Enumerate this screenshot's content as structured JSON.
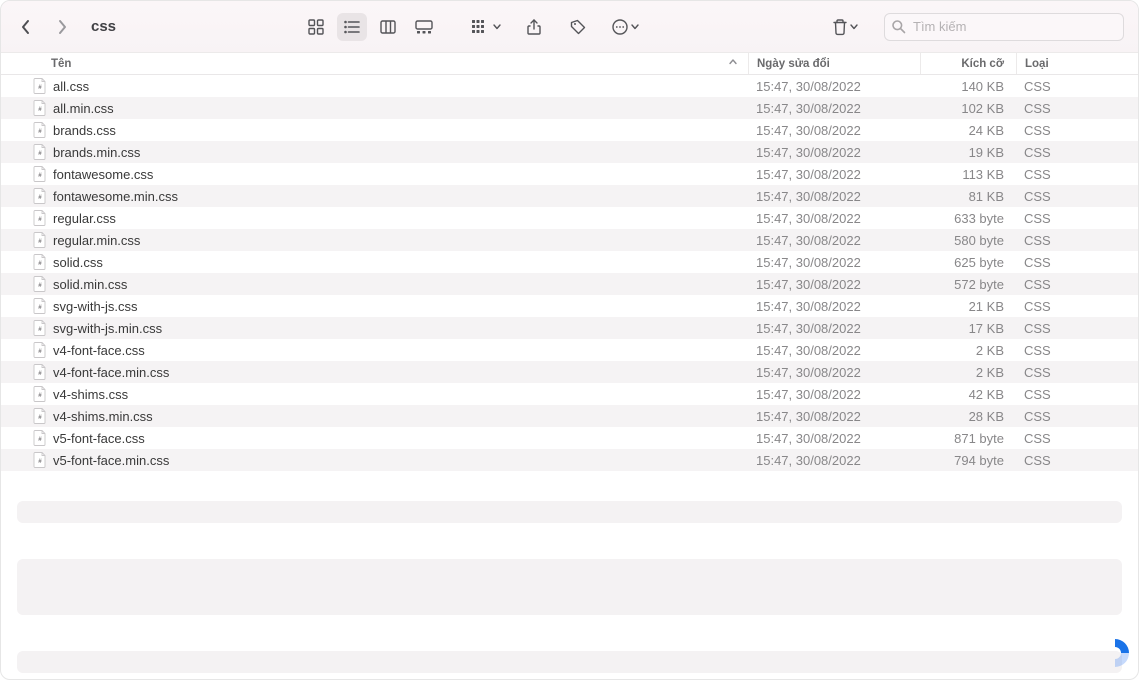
{
  "toolbar": {
    "folder_title": "css"
  },
  "search": {
    "placeholder": "Tìm kiếm"
  },
  "columns": {
    "name": "Tên",
    "date": "Ngày sửa đổi",
    "size": "Kích cỡ",
    "kind": "Loại"
  },
  "files": [
    {
      "name": "all.css",
      "date": "15:47, 30/08/2022",
      "size": "140 KB",
      "kind": "CSS"
    },
    {
      "name": "all.min.css",
      "date": "15:47, 30/08/2022",
      "size": "102 KB",
      "kind": "CSS"
    },
    {
      "name": "brands.css",
      "date": "15:47, 30/08/2022",
      "size": "24 KB",
      "kind": "CSS"
    },
    {
      "name": "brands.min.css",
      "date": "15:47, 30/08/2022",
      "size": "19 KB",
      "kind": "CSS"
    },
    {
      "name": "fontawesome.css",
      "date": "15:47, 30/08/2022",
      "size": "113 KB",
      "kind": "CSS"
    },
    {
      "name": "fontawesome.min.css",
      "date": "15:47, 30/08/2022",
      "size": "81 KB",
      "kind": "CSS"
    },
    {
      "name": "regular.css",
      "date": "15:47, 30/08/2022",
      "size": "633 byte",
      "kind": "CSS"
    },
    {
      "name": "regular.min.css",
      "date": "15:47, 30/08/2022",
      "size": "580 byte",
      "kind": "CSS"
    },
    {
      "name": "solid.css",
      "date": "15:47, 30/08/2022",
      "size": "625 byte",
      "kind": "CSS"
    },
    {
      "name": "solid.min.css",
      "date": "15:47, 30/08/2022",
      "size": "572 byte",
      "kind": "CSS"
    },
    {
      "name": "svg-with-js.css",
      "date": "15:47, 30/08/2022",
      "size": "21 KB",
      "kind": "CSS"
    },
    {
      "name": "svg-with-js.min.css",
      "date": "15:47, 30/08/2022",
      "size": "17 KB",
      "kind": "CSS"
    },
    {
      "name": "v4-font-face.css",
      "date": "15:47, 30/08/2022",
      "size": "2 KB",
      "kind": "CSS"
    },
    {
      "name": "v4-font-face.min.css",
      "date": "15:47, 30/08/2022",
      "size": "2 KB",
      "kind": "CSS"
    },
    {
      "name": "v4-shims.css",
      "date": "15:47, 30/08/2022",
      "size": "42 KB",
      "kind": "CSS"
    },
    {
      "name": "v4-shims.min.css",
      "date": "15:47, 30/08/2022",
      "size": "28 KB",
      "kind": "CSS"
    },
    {
      "name": "v5-font-face.css",
      "date": "15:47, 30/08/2022",
      "size": "871 byte",
      "kind": "CSS"
    },
    {
      "name": "v5-font-face.min.css",
      "date": "15:47, 30/08/2022",
      "size": "794 byte",
      "kind": "CSS"
    }
  ]
}
